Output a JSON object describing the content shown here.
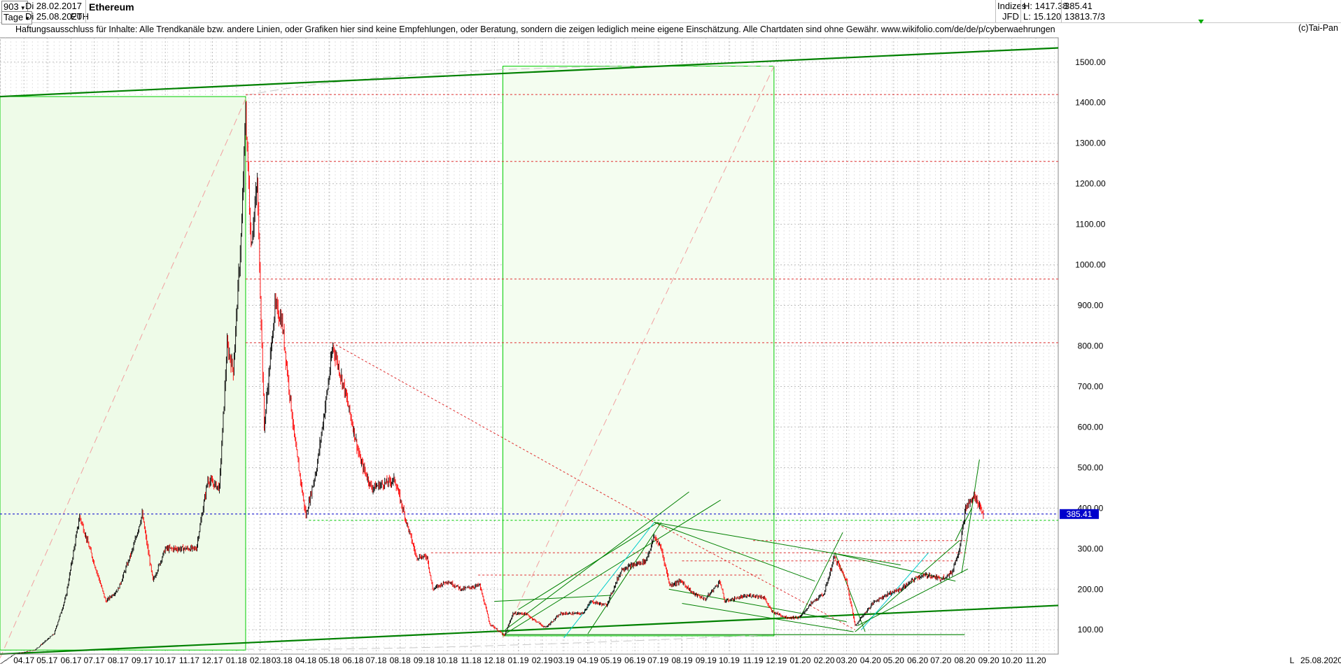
{
  "header": {
    "bars": "903",
    "start_date": "Di 28.02.2017",
    "interval": "Tage",
    "end_date": "Di 25.08.2020",
    "symbol": "ETH",
    "title": "Ethereum",
    "category": "Indizes",
    "source": "JFD",
    "high": "H: 1417.38",
    "low": "L: 15.120",
    "last_value": "385.41",
    "volume": "13813.7/3"
  },
  "disclaimer": "Haftungsausschluss für Inhalte: Alle Trendkanäle bzw. andere Linien, oder Grafiken hier sind keine Empfehlungen, oder Beratung, sondern die zeigen lediglich meine eigene Einschätzung. Alle Chartdaten sind ohne Gewähr.  www.wikifolio.com/de/de/p/cyberwaehrungen",
  "copyright": "(c)Tai-Pan",
  "colors": {
    "up": "#000000",
    "down": "#ff0000",
    "green": "#008000",
    "lightgreen": "#00cc00",
    "price_marker": "#0000cc",
    "cyan": "#00cccc"
  },
  "chart_data": {
    "type": "candlestick",
    "ylim": [
      40,
      1560
    ],
    "y_ticks": [
      "100.00",
      "200.00",
      "300.00",
      "400.00",
      "500.00",
      "600.00",
      "700.00",
      "800.00",
      "900.00",
      "1000.00",
      "1100.00",
      "1200.00",
      "1300.00",
      "1400.00",
      "1500.00"
    ],
    "x_ticks": [
      "04.17",
      "05.17",
      "06.17",
      "07.17",
      "08.17",
      "09.17",
      "10.17",
      "11.17",
      "12.17",
      "01.18",
      "02.18",
      "03.18",
      "04.18",
      "05.18",
      "06.18",
      "07.18",
      "08.18",
      "09.18",
      "10.18",
      "11.18",
      "12.18",
      "01.19",
      "02.19",
      "03.19",
      "04.19",
      "05.19",
      "06.19",
      "07.19",
      "08.19",
      "09.19",
      "10.19",
      "11.19",
      "12.19",
      "01.20",
      "02.20",
      "03.20",
      "04.20",
      "05.20",
      "06.20",
      "07.20",
      "08.20",
      "09.20",
      "10.20",
      "11.20"
    ],
    "x_end_label": "25.08.2020",
    "scale_marker": "L",
    "last_price": "385.41",
    "last_price_value": 385.41,
    "price_path": [
      [
        "2017-03-01",
        16
      ],
      [
        "2017-03-20",
        40
      ],
      [
        "2017-04-15",
        50
      ],
      [
        "2017-05-10",
        90
      ],
      [
        "2017-05-25",
        180
      ],
      [
        "2017-06-12",
        380
      ],
      [
        "2017-06-25",
        300
      ],
      [
        "2017-07-16",
        170
      ],
      [
        "2017-08-01",
        200
      ],
      [
        "2017-08-20",
        300
      ],
      [
        "2017-09-01",
        385
      ],
      [
        "2017-09-15",
        220
      ],
      [
        "2017-10-01",
        300
      ],
      [
        "2017-10-20",
        300
      ],
      [
        "2017-11-10",
        300
      ],
      [
        "2017-11-25",
        470
      ],
      [
        "2017-12-10",
        450
      ],
      [
        "2017-12-20",
        800
      ],
      [
        "2017-12-28",
        740
      ],
      [
        "2018-01-08",
        1100
      ],
      [
        "2018-01-13",
        1380
      ],
      [
        "2018-01-20",
        1050
      ],
      [
        "2018-01-28",
        1200
      ],
      [
        "2018-02-06",
        600
      ],
      [
        "2018-02-20",
        900
      ],
      [
        "2018-03-01",
        860
      ],
      [
        "2018-03-18",
        560
      ],
      [
        "2018-04-01",
        380
      ],
      [
        "2018-04-15",
        500
      ],
      [
        "2018-04-28",
        680
      ],
      [
        "2018-05-06",
        800
      ],
      [
        "2018-05-20",
        700
      ],
      [
        "2018-06-01",
        600
      ],
      [
        "2018-06-10",
        520
      ],
      [
        "2018-06-25",
        450
      ],
      [
        "2018-07-10",
        460
      ],
      [
        "2018-07-25",
        470
      ],
      [
        "2018-08-10",
        360
      ],
      [
        "2018-08-22",
        280
      ],
      [
        "2018-09-05",
        280
      ],
      [
        "2018-09-12",
        200
      ],
      [
        "2018-10-01",
        220
      ],
      [
        "2018-10-20",
        200
      ],
      [
        "2018-11-12",
        210
      ],
      [
        "2018-11-25",
        115
      ],
      [
        "2018-12-14",
        85
      ],
      [
        "2018-12-25",
        140
      ],
      [
        "2019-01-10",
        140
      ],
      [
        "2019-02-05",
        105
      ],
      [
        "2019-02-25",
        140
      ],
      [
        "2019-03-25",
        140
      ],
      [
        "2019-04-05",
        170
      ],
      [
        "2019-04-25",
        160
      ],
      [
        "2019-05-15",
        250
      ],
      [
        "2019-05-31",
        260
      ],
      [
        "2019-06-15",
        270
      ],
      [
        "2019-06-26",
        330
      ],
      [
        "2019-07-05",
        300
      ],
      [
        "2019-07-16",
        210
      ],
      [
        "2019-07-31",
        220
      ],
      [
        "2019-08-15",
        190
      ],
      [
        "2019-08-31",
        175
      ],
      [
        "2019-09-19",
        220
      ],
      [
        "2019-09-25",
        170
      ],
      [
        "2019-10-15",
        180
      ],
      [
        "2019-10-31",
        185
      ],
      [
        "2019-11-15",
        180
      ],
      [
        "2019-11-25",
        145
      ],
      [
        "2019-12-15",
        130
      ],
      [
        "2019-12-31",
        130
      ],
      [
        "2020-01-15",
        165
      ],
      [
        "2020-02-01",
        190
      ],
      [
        "2020-02-14",
        280
      ],
      [
        "2020-03-01",
        220
      ],
      [
        "2020-03-12",
        110
      ],
      [
        "2020-03-20",
        130
      ],
      [
        "2020-04-06",
        170
      ],
      [
        "2020-04-25",
        190
      ],
      [
        "2020-05-10",
        200
      ],
      [
        "2020-05-31",
        230
      ],
      [
        "2020-06-15",
        235
      ],
      [
        "2020-06-30",
        225
      ],
      [
        "2020-07-15",
        240
      ],
      [
        "2020-07-25",
        300
      ],
      [
        "2020-08-02",
        400
      ],
      [
        "2020-08-14",
        430
      ],
      [
        "2020-08-25",
        385
      ]
    ],
    "horizontal_levels": [
      {
        "value": 1420,
        "color": "red",
        "style": "dashed"
      },
      {
        "value": 1255,
        "color": "red",
        "style": "dashed"
      },
      {
        "value": 965,
        "color": "red",
        "style": "dashed"
      },
      {
        "value": 808,
        "color": "red",
        "style": "dashed"
      },
      {
        "value": 370,
        "color": "green",
        "style": "dashed"
      },
      {
        "value": 385.41,
        "color": "blue",
        "style": "dashed"
      }
    ]
  }
}
